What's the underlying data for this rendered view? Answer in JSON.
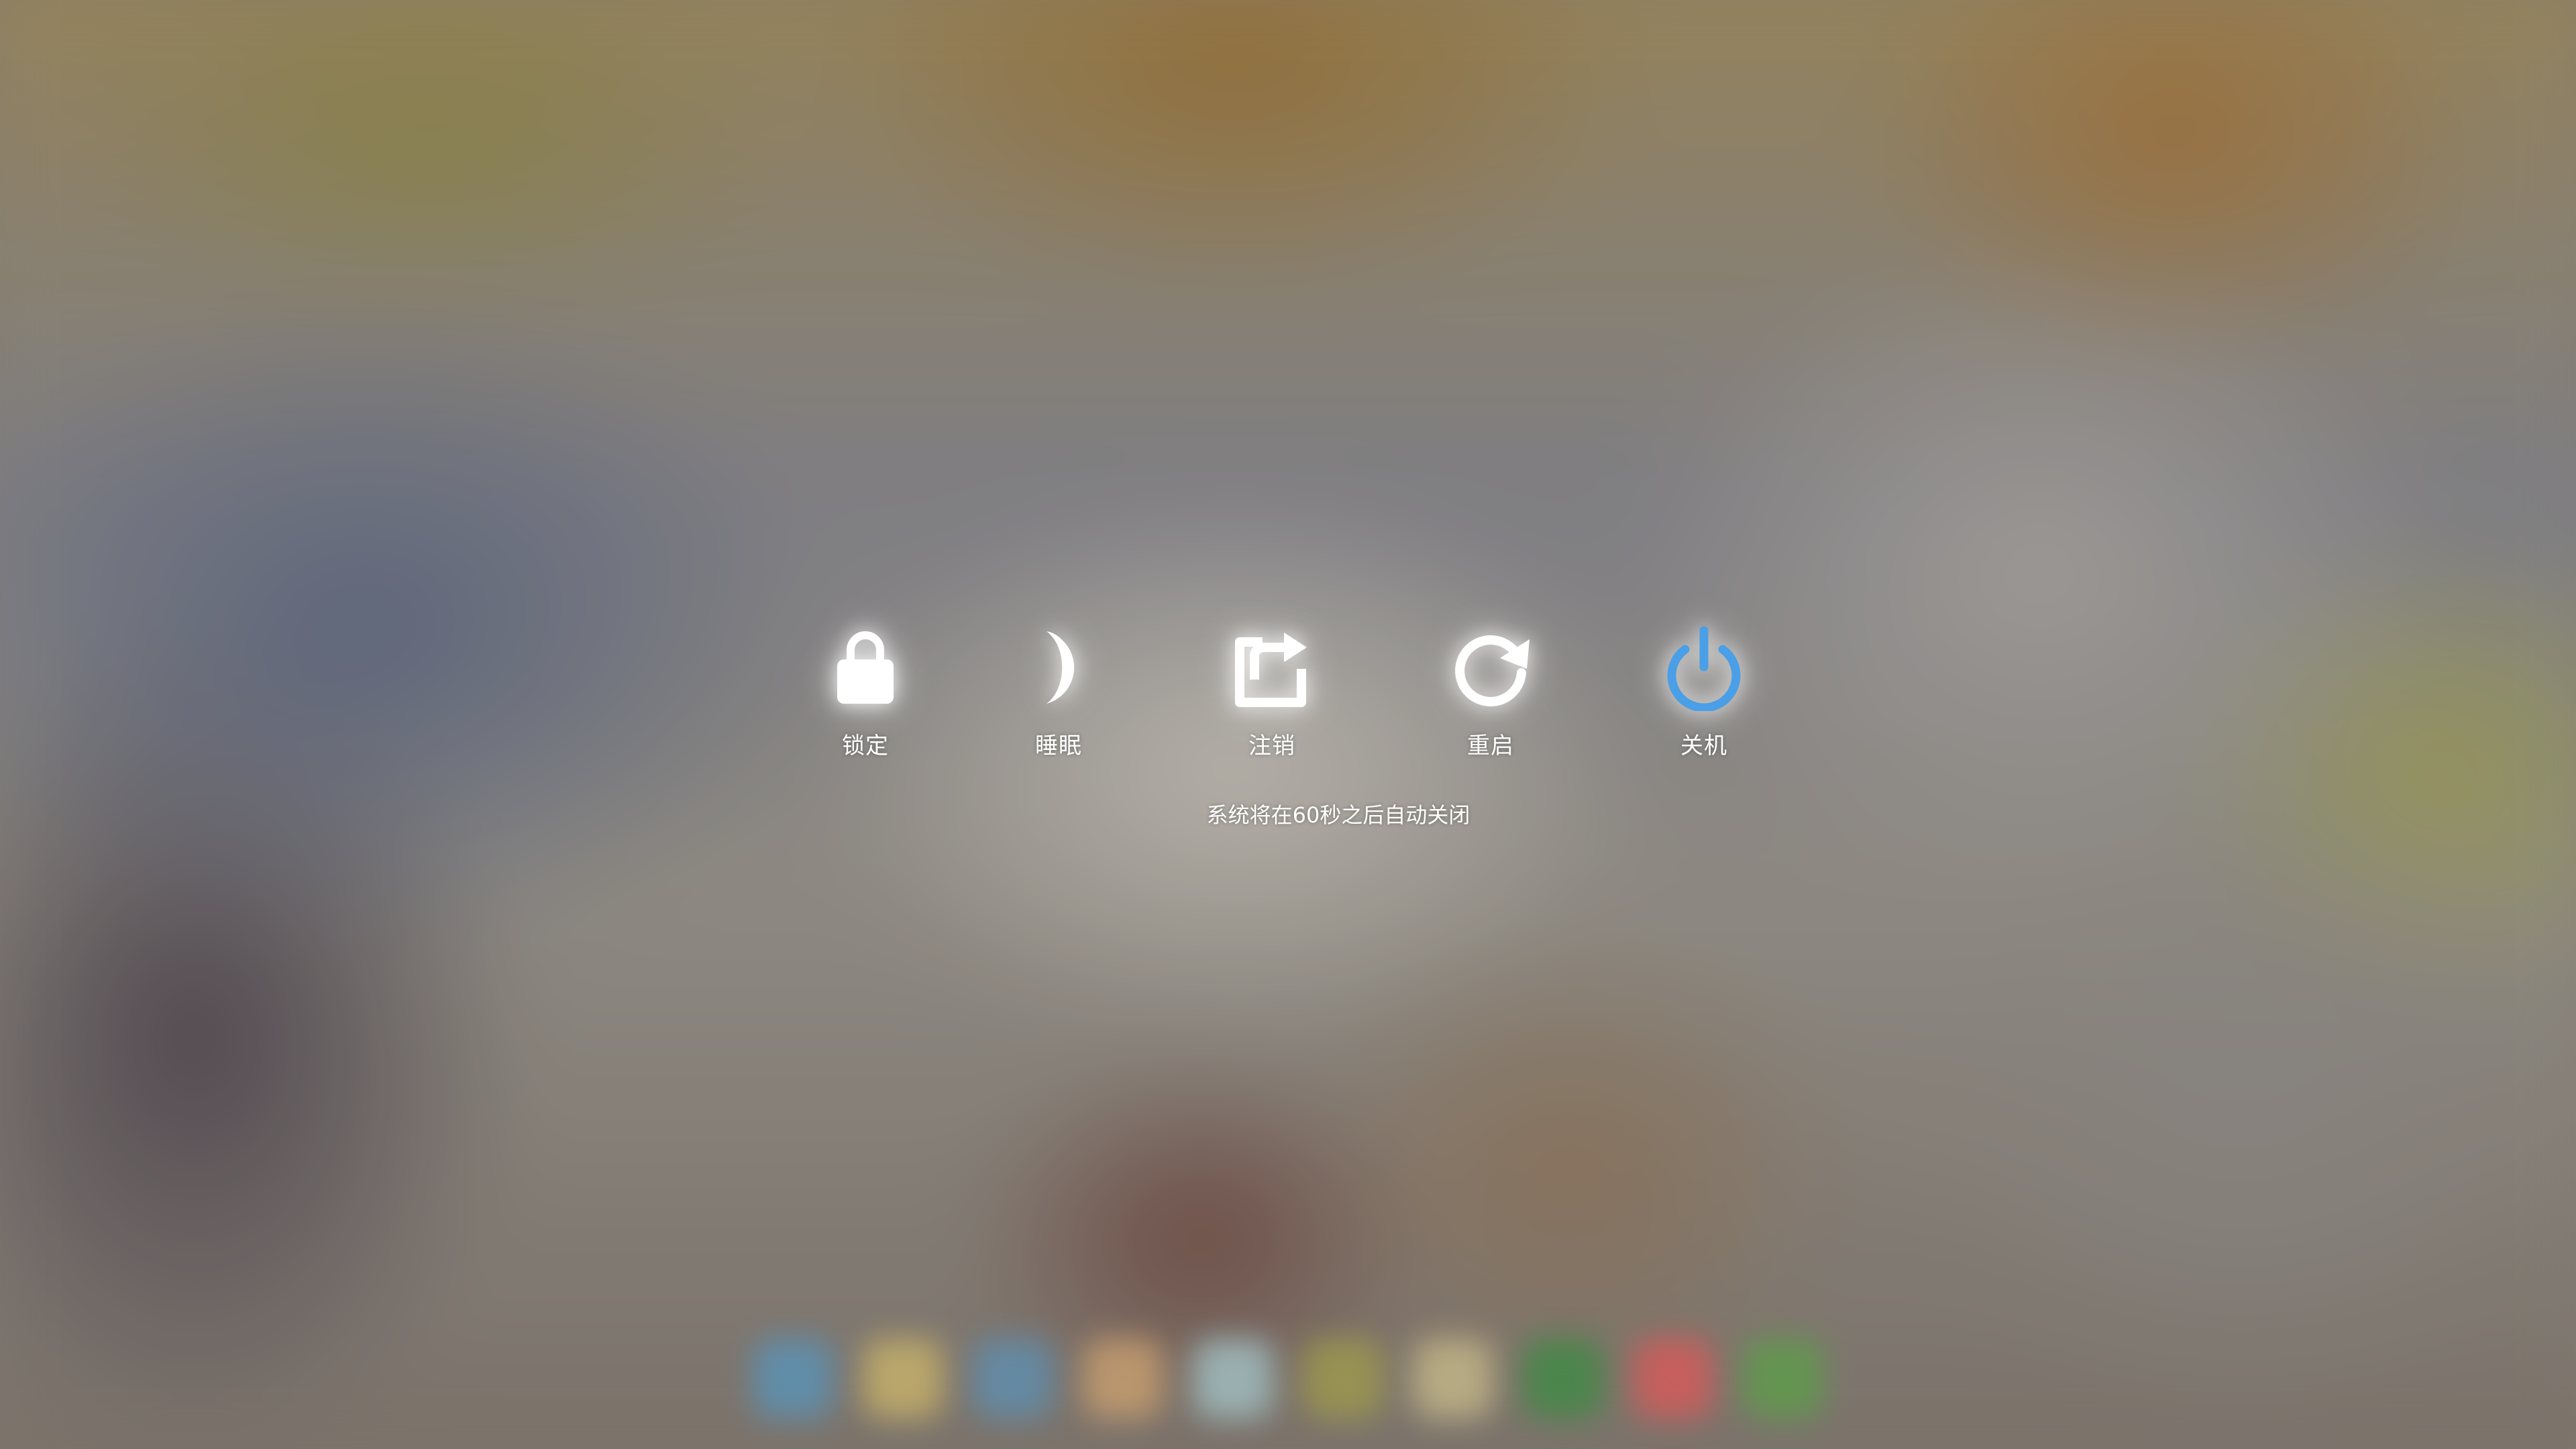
{
  "actions": [
    {
      "id": "lock",
      "label": "锁定",
      "icon": "lock-icon"
    },
    {
      "id": "sleep",
      "label": "睡眠",
      "icon": "moon-icon"
    },
    {
      "id": "logout",
      "label": "注销",
      "icon": "logout-icon"
    },
    {
      "id": "restart",
      "label": "重启",
      "icon": "restart-icon"
    },
    {
      "id": "shutdown",
      "label": "关机",
      "icon": "power-icon",
      "active": true
    }
  ],
  "countdown_text": "系统将在60秒之后自动关闭",
  "colors": {
    "icon": "#ffffff",
    "active_icon": "#4a9fe6"
  },
  "dock": {
    "icon_colors": [
      "#5a93b8",
      "#c9b36a",
      "#5f8fb0",
      "#caa070",
      "#a3c1c4",
      "#9f9a4d",
      "#c5b889",
      "#3f8a45",
      "#d85a5a",
      "#5e9d4a"
    ]
  }
}
